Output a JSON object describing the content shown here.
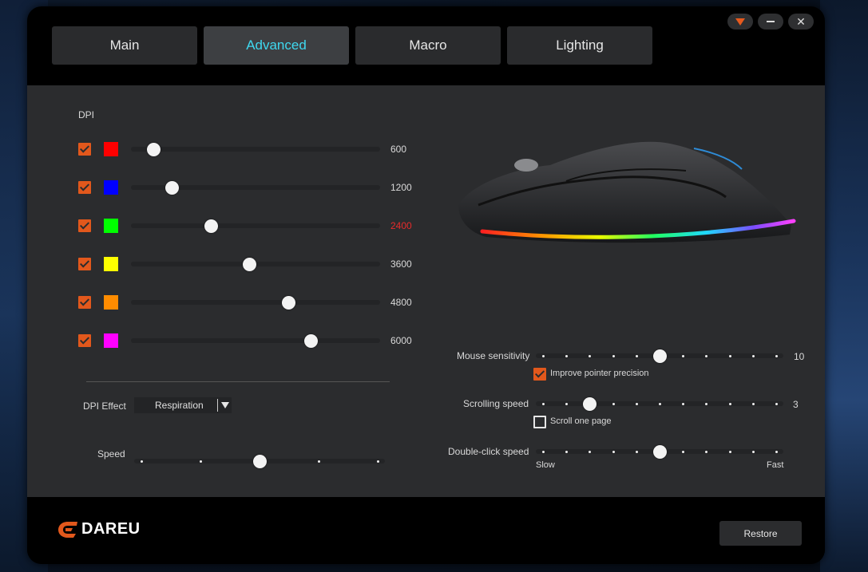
{
  "tabs": [
    {
      "label": "Main",
      "active": false
    },
    {
      "label": "Advanced",
      "active": true
    },
    {
      "label": "Macro",
      "active": false
    },
    {
      "label": "Lighting",
      "active": false
    }
  ],
  "window_controls": {
    "menu_icon": "orange-triangle-icon",
    "minimize_icon": "minimize-icon",
    "close_icon": "close-icon",
    "close_glyph": "✕"
  },
  "dpi": {
    "title": "DPI",
    "levels": [
      {
        "checked": true,
        "color": "#ff0000",
        "value": "600",
        "slider_fraction": 0.09,
        "active": false
      },
      {
        "checked": true,
        "color": "#0000ff",
        "value": "1200",
        "slider_fraction": 0.165,
        "active": false
      },
      {
        "checked": true,
        "color": "#00ff00",
        "value": "2400",
        "slider_fraction": 0.32,
        "active": true
      },
      {
        "checked": true,
        "color": "#ffff00",
        "value": "3600",
        "slider_fraction": 0.475,
        "active": false
      },
      {
        "checked": true,
        "color": "#ff8c00",
        "value": "4800",
        "slider_fraction": 0.63,
        "active": false
      },
      {
        "checked": true,
        "color": "#ff00ff",
        "value": "6000",
        "slider_fraction": 0.72,
        "active": false
      }
    ],
    "effect_label": "DPI Effect",
    "effect_value": "Respiration",
    "speed_label": "Speed",
    "speed_level": 3,
    "speed_steps": 5
  },
  "mouse_settings": {
    "sensitivity_label": "Mouse sensitivity",
    "sensitivity_value": "10",
    "sensitivity_level": 6,
    "improve_precision_label": "Improve pointer precision",
    "improve_precision_checked": true,
    "scrolling_label": "Scrolling speed",
    "scrolling_value": "3",
    "scrolling_level": 3,
    "scroll_one_page_label": "Scroll one page",
    "scroll_one_page_checked": false,
    "double_click_label": "Double-click speed",
    "double_click_level": 6,
    "slow_label": "Slow",
    "fast_label": "Fast",
    "steps": 11
  },
  "footer": {
    "logo_text": "DAREU",
    "restore_label": "Restore"
  },
  "colors": {
    "accent": "#e2581c",
    "active_tab_text": "#3fd8ef",
    "active_dpi_value": "#e62b2b"
  }
}
